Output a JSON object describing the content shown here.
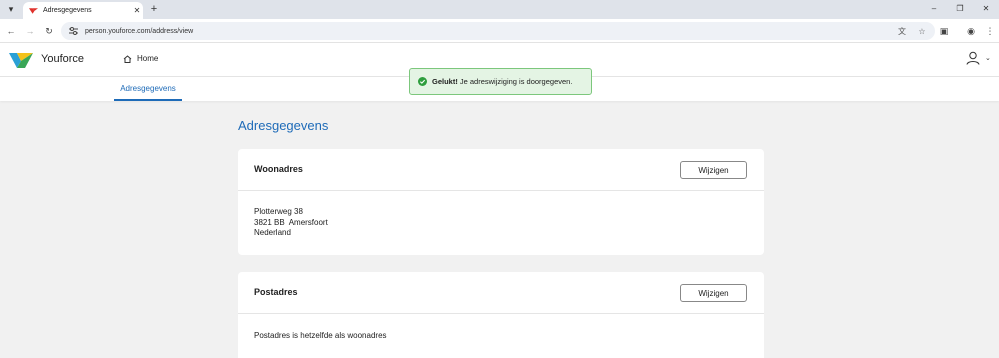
{
  "browser": {
    "tab_title": "Adresgegevens",
    "url": "person.youforce.com/address/view"
  },
  "app": {
    "brand": "Youforce",
    "home_label": "Home",
    "subnav_label": "Adresgegevens"
  },
  "toast": {
    "strong": "Gelukt!",
    "message": "Je adreswijziging is doorgegeven."
  },
  "page": {
    "title": "Adresgegevens"
  },
  "cards": [
    {
      "title": "Woonadres",
      "button": "Wijzigen",
      "lines": [
        "Plotterweg 38",
        "3821 BB  Amersfoort",
        "Nederland"
      ]
    },
    {
      "title": "Postadres",
      "button": "Wijzigen",
      "lines": [
        "Postadres is hetzelfde als woonadres"
      ]
    }
  ],
  "colors": {
    "accent": "#1e6bb8",
    "success_bg": "#e4f4e4",
    "success_border": "#7cc77c",
    "success_icon": "#2e9e3e"
  }
}
